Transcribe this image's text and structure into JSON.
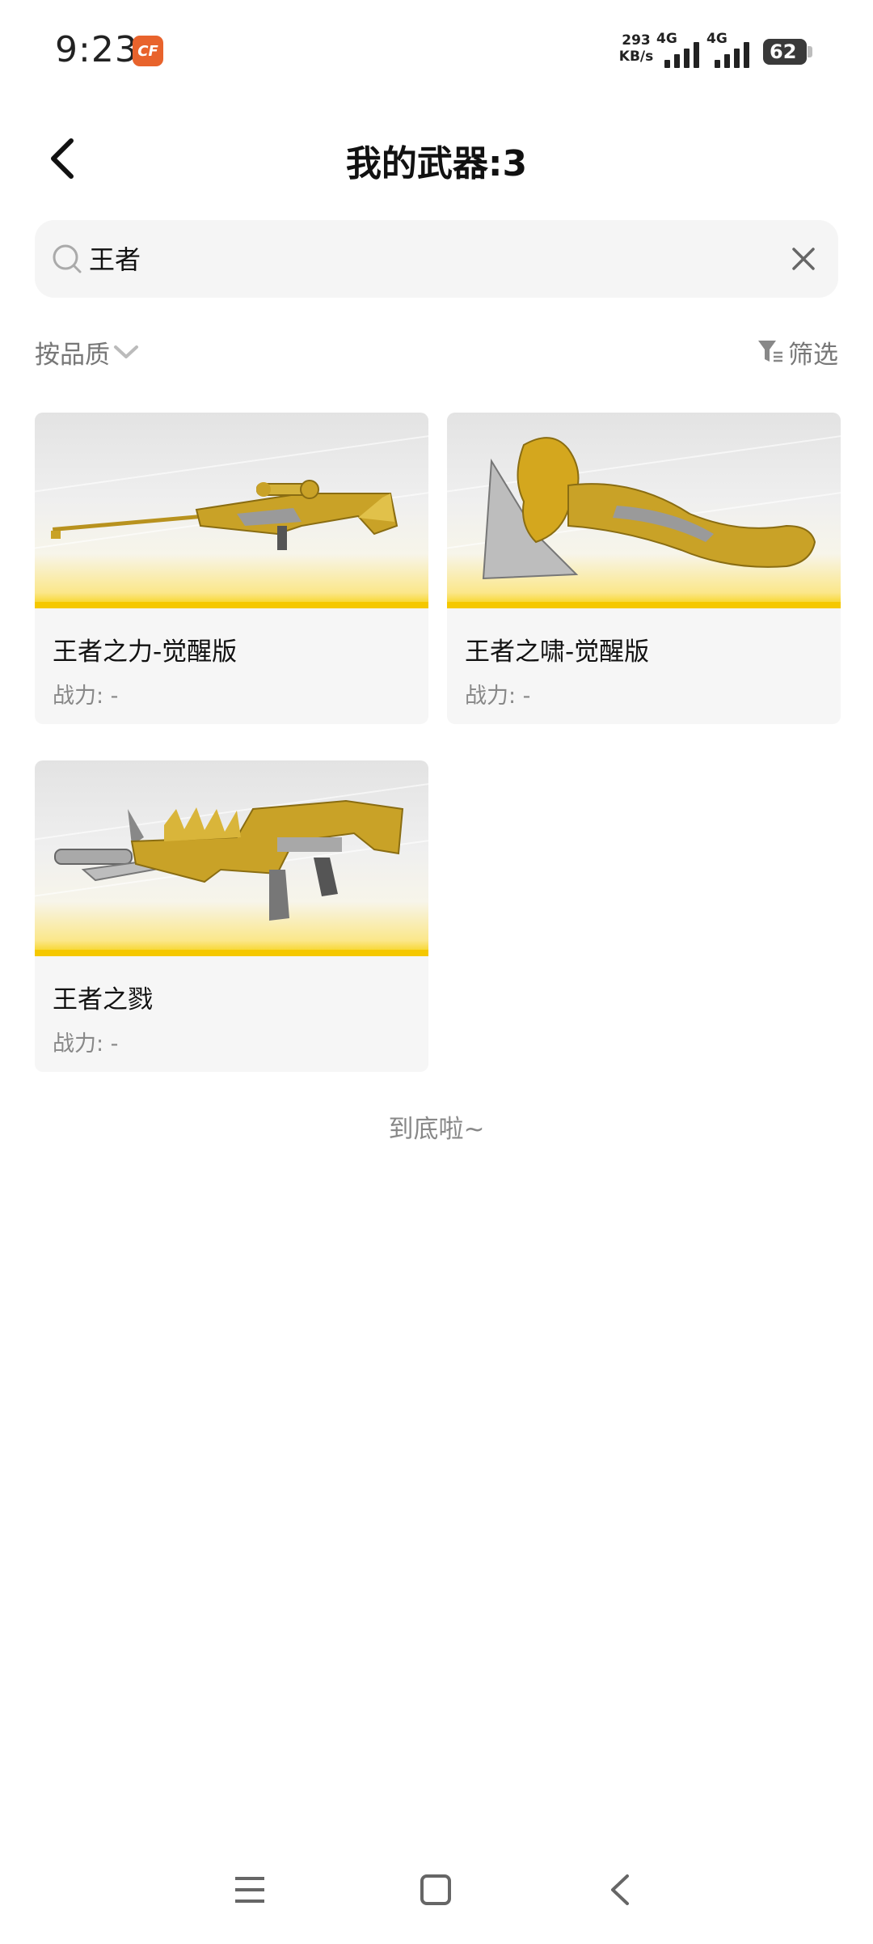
{
  "status_bar": {
    "time": "9:23",
    "app_badge": "CF",
    "net_speed_value": "293",
    "net_speed_unit": "KB/s",
    "signal1_label": "4G",
    "signal2_label": "4G",
    "battery": "62"
  },
  "header": {
    "back_icon": "chevron-left-icon",
    "title": "我的武器:3"
  },
  "search": {
    "value": "王者",
    "icons": [
      "search-icon",
      "close-icon"
    ]
  },
  "toolbar": {
    "sort_label": "按品质",
    "filter_label": "筛选"
  },
  "weapons": [
    {
      "name": "王者之力-觉醒版",
      "power": "战力: -",
      "image": "golden-sniper-rifle"
    },
    {
      "name": "王者之啸-觉醒版",
      "power": "战力: -",
      "image": "golden-lion-axe"
    },
    {
      "name": "王者之戮",
      "power": "战力: -",
      "image": "golden-assault-rifle"
    }
  ],
  "footer": "到底啦~",
  "colors": {
    "accent_yellow": "#f5c800",
    "card_bg": "#f6f6f6",
    "search_bg": "#f5f5f5",
    "gold": "#c9a227",
    "app_badge": "#e8632c"
  }
}
